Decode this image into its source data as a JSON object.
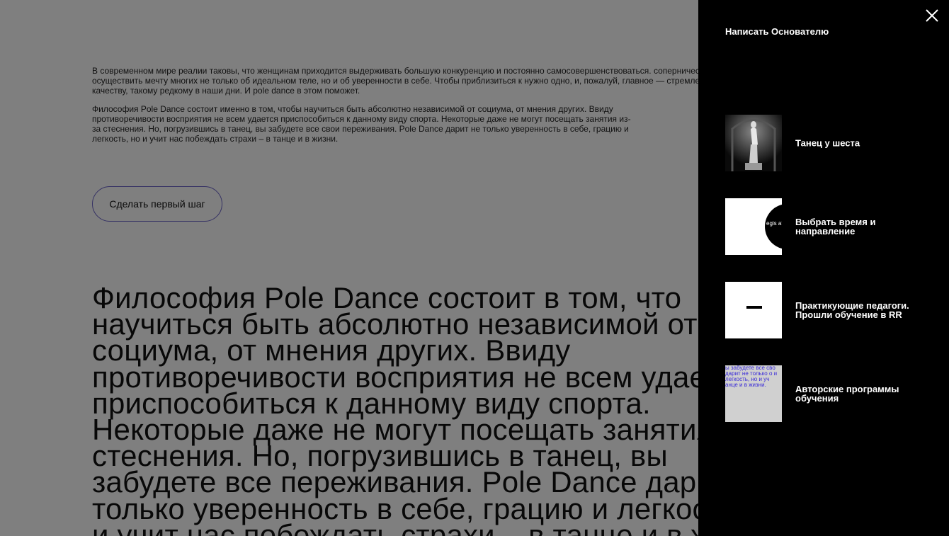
{
  "page": {
    "intro_paragraph_1": "В современном мире реалии таковы, что женщинам приходится выдерживать большую конкуренцию и постоянно самосовершенствоваться. соперничества. Пилон помогает осуществить мечту многих не только об идеальном теле, но и об уверенности в себе. Чтобы приблизиться к нужно одно, и, пожалуй, главное — стремление к женственности, качеству, такому редкому в наши дни. И pole dance в этом поможет.",
    "intro_paragraph_2": "Философия Pole Dance состоит именно в том, чтобы научиться быть абсолютно независимой от социума, от мнения других. Ввиду противоречивости восприятия не всем удается приспособиться к данному виду спорта. Некоторые даже не могут посещать занятия из-за стеснения. Но, погрузившись в танец, вы забудете все свои переживания. Pole Dance дарит не только уверенность в себе, грацию и легкость, но и учит нас побеждать страхи – в танце и в жизни.",
    "cta_button": "Сделать первый шаг",
    "big_text": "Философия Pole Dance состоит в том, что научиться быть абсолютно независимой от социума, от мнения других. Ввиду противоречивости восприятия не всем удается приспособиться к данному виду спорта. Некоторые даже не могут посещать занятия из-за стеснения. Но, погрузившись в танец, вы забудете все переживания. Pole Dance дарит не только уверенность в себе, грацию и легкость, но и учит нас побеждать страхи – в танце и в жизни."
  },
  "menu": {
    "title": "Написать Основателю",
    "close_icon": "close-icon",
    "items": [
      {
        "label": "Танец у шеста",
        "thumb": "statue-photo"
      },
      {
        "label": "Выбрать время и направление",
        "thumb": "register-logo",
        "thumb_text": "egis ation"
      },
      {
        "label": "Практикующие педагоги. Прошли обучение в RR",
        "thumb": "white-card"
      },
      {
        "label": "Авторские программы обучения",
        "thumb": "text-snippet",
        "thumb_text": "ы забудете все сво дарит не только о и легкость, но и уч анце и в жизни."
      }
    ]
  },
  "colors": {
    "panel_bg": "#000000",
    "cta_border": "#6a63c8",
    "overlay": "rgba(0,0,0,0.5)"
  }
}
